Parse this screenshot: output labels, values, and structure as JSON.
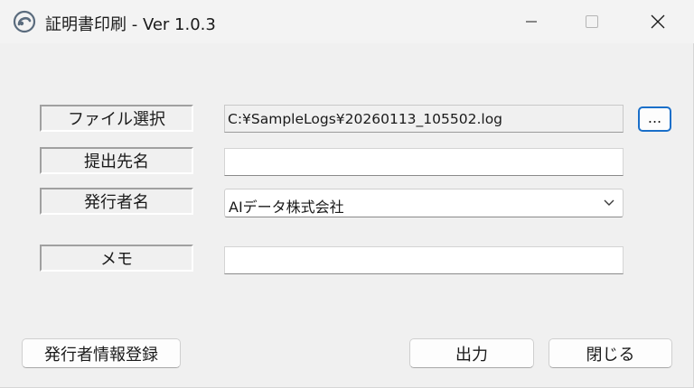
{
  "window": {
    "title": "証明書印刷 - Ver 1.0.3",
    "icon": "swirl-app-icon",
    "controls": {
      "minimize_icon": "minimize-icon",
      "maximize_icon": "maximize-icon",
      "close_icon": "close-icon"
    }
  },
  "form": {
    "file_select": {
      "label": "ファイル選択",
      "value": "C:¥SampleLogs¥20260113_105502.log",
      "browse_label": "..."
    },
    "submit_to": {
      "label": "提出先名",
      "value": ""
    },
    "issuer": {
      "label": "発行者名",
      "selected": "AIデータ株式会社"
    },
    "memo": {
      "label": "メモ",
      "value": ""
    }
  },
  "buttons": {
    "register_issuer": "発行者情報登録",
    "output": "出力",
    "close": "閉じる"
  },
  "colors": {
    "background": "#f0f0f0",
    "focus_border": "#1a6fc9",
    "text": "#1a1a1a"
  }
}
